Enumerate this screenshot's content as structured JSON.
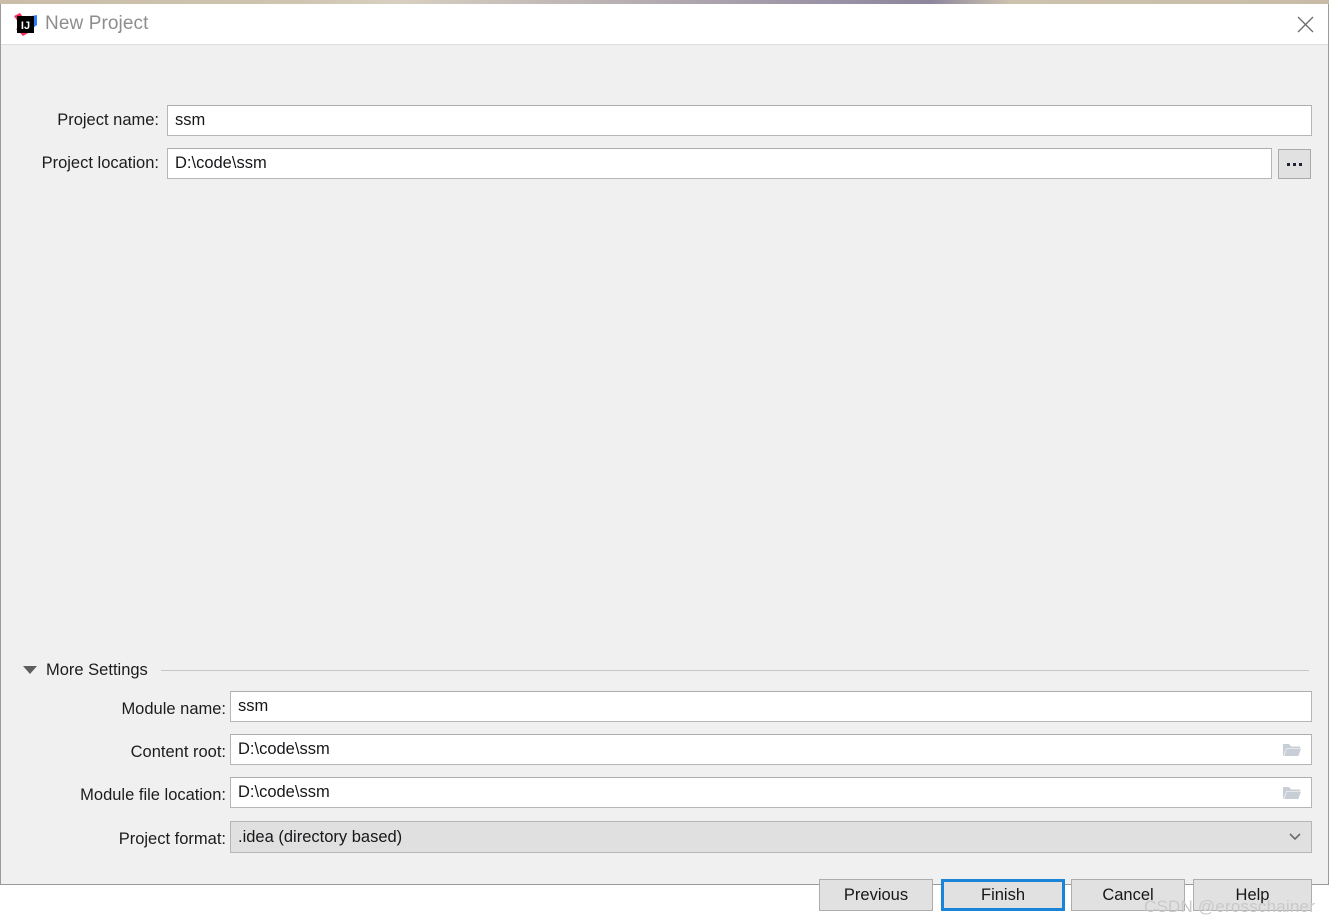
{
  "window": {
    "title": "New Project",
    "logo_icon": "intellij-idea-logo",
    "close_icon": "close-icon"
  },
  "top_form": {
    "fields": [
      {
        "label": "Project name:",
        "value": "ssm",
        "name": "project-name"
      },
      {
        "label": "Project location:",
        "value": "D:\\code\\ssm",
        "name": "project-location"
      }
    ],
    "browse_button_label": "...",
    "browse_button_icon": "ellipsis-icon"
  },
  "more_settings": {
    "label": "More Settings",
    "expanded": true,
    "toggle_icon": "triangle-down-icon",
    "fields": [
      {
        "label": "Module name:",
        "value": "ssm",
        "name": "module-name",
        "icon": null
      },
      {
        "label": "Content root:",
        "value": "D:\\code\\ssm",
        "name": "content-root",
        "icon": "folder-icon"
      },
      {
        "label": "Module file location:",
        "value": "D:\\code\\ssm",
        "name": "module-file-location",
        "icon": "folder-icon"
      }
    ],
    "project_format": {
      "label": "Project format:",
      "value": ".idea (directory based)",
      "dropdown_icon": "chevron-down-icon"
    }
  },
  "buttons": {
    "previous": "Previous",
    "finish": "Finish",
    "cancel": "Cancel",
    "help": "Help",
    "focused": "Finish"
  },
  "watermark": {
    "text": "CSDN @erosschainer"
  },
  "colors": {
    "dialog_background": "#f0f0f0",
    "titlebar_background": "#ffffff",
    "title_text": "#8d8d8d",
    "field_background": "#ffffff",
    "field_border": "#b6b6b6",
    "button_background": "#e1e1e1",
    "focus_accent": "#1a85d8",
    "combo_background": "#e0e0e0",
    "watermark": "#c9c9c9"
  }
}
